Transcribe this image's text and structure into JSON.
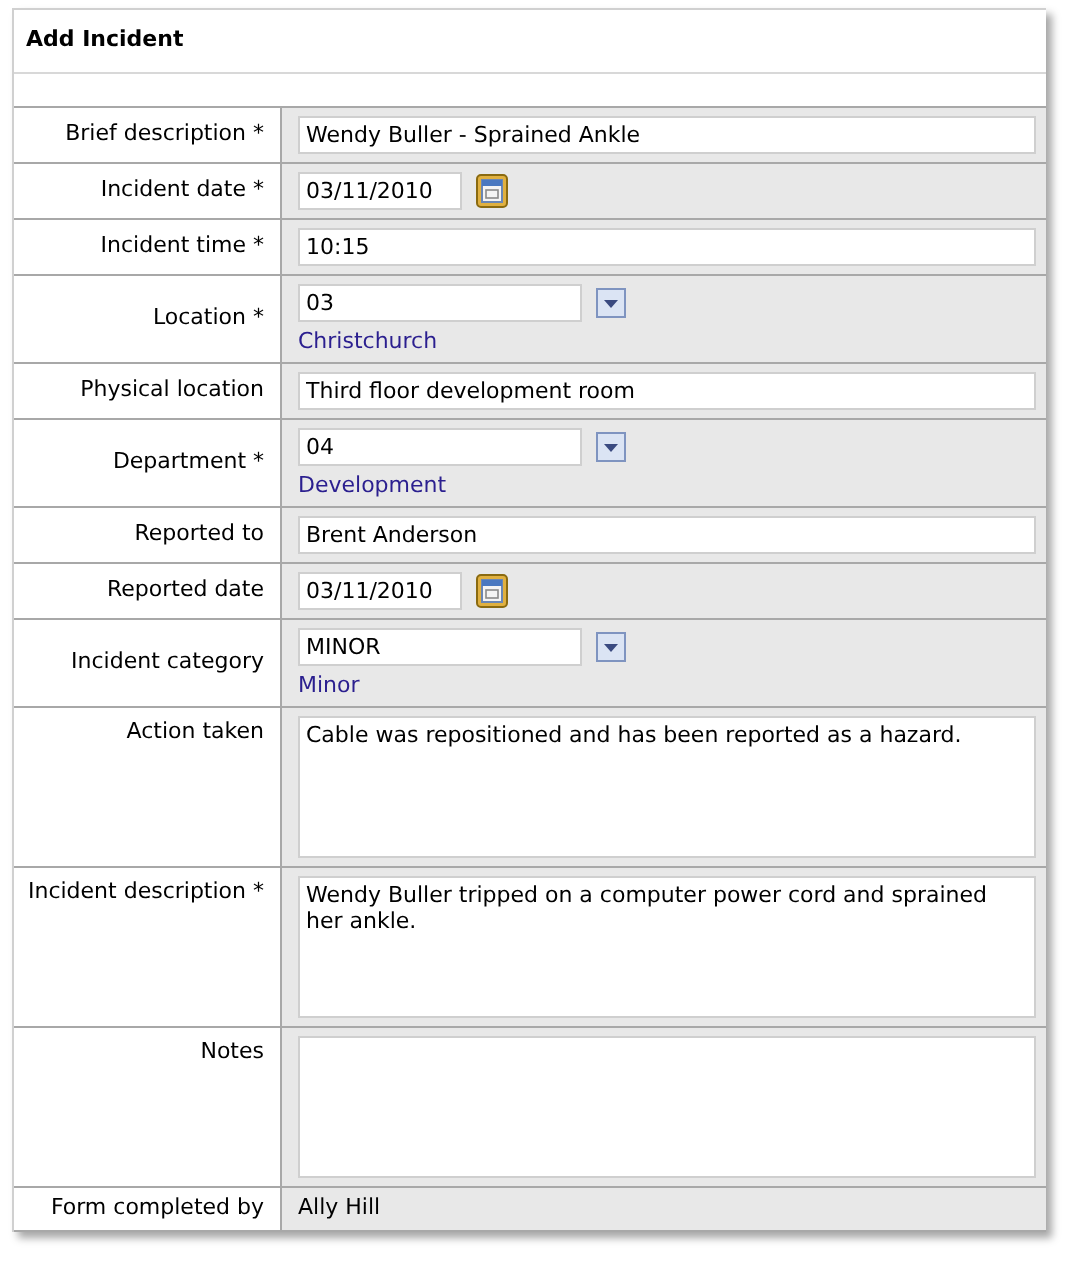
{
  "title": "Add Incident",
  "fields": [
    {
      "kind": "text",
      "label": "Brief description *",
      "value": "Wendy Buller - Sprained Ankle"
    },
    {
      "kind": "date",
      "label": "Incident date *",
      "value": "03/11/2010"
    },
    {
      "kind": "text",
      "label": "Incident time *",
      "value": "10:15"
    },
    {
      "kind": "lookup",
      "label": "Location *",
      "value": "03",
      "description": "Christchurch"
    },
    {
      "kind": "text",
      "label": "Physical location",
      "value": "Third floor development room"
    },
    {
      "kind": "lookup",
      "label": "Department *",
      "value": "04",
      "description": "Development"
    },
    {
      "kind": "text",
      "label": "Reported to",
      "value": "Brent Anderson"
    },
    {
      "kind": "date",
      "label": "Reported date",
      "value": "03/11/2010"
    },
    {
      "kind": "lookup",
      "label": "Incident category",
      "value": "MINOR",
      "description": "Minor"
    },
    {
      "kind": "textarea",
      "label": "Action taken",
      "value": "Cable was repositioned and has been reported as a hazard."
    },
    {
      "kind": "textarea",
      "label": "Incident description *",
      "value": "Wendy Buller tripped on a computer power cord and sprained her ankle."
    },
    {
      "kind": "textarea",
      "label": "Notes"
    },
    {
      "kind": "readonly",
      "label": "Form completed by",
      "value": "Ally Hill"
    }
  ]
}
